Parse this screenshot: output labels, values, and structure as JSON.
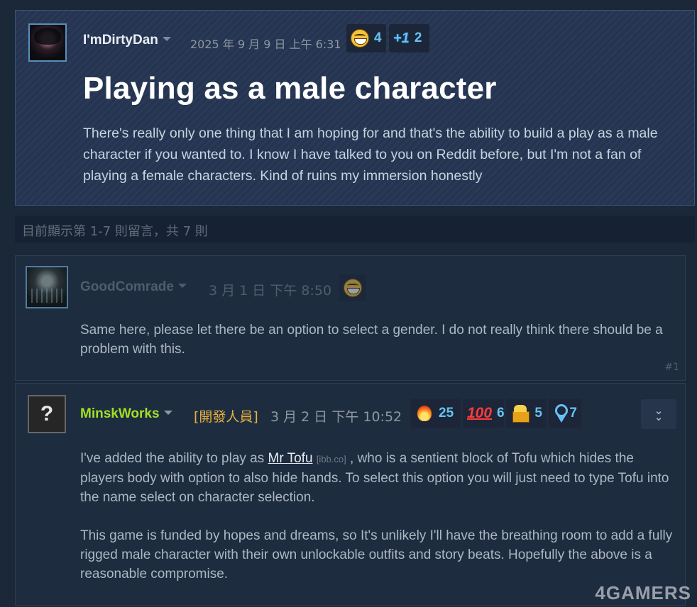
{
  "post": {
    "author": "I'mDirtyDan",
    "date": "2025 年 9 月 9 日 上午 6:31",
    "reactions": [
      {
        "icon": "grin-emoji-icon",
        "count": "4"
      },
      {
        "icon": "plus-one-icon",
        "count": "2"
      }
    ],
    "title": "Playing as a male character",
    "body": "There's really only one thing that I am hoping for and that's the ability to build a play as a male character if you wanted to. I know I have talked to you on Reddit before, but I'm not a fan of playing a female characters. Kind of ruins my immersion honestly"
  },
  "comments_info": "目前顯示第 1-7 則留言，共 7 則",
  "comments": [
    {
      "author": "GoodComrade",
      "date": "3 月 1 日 下午 8:50",
      "reaction_icon": "grin-emoji-icon",
      "body": "Same here, please let there be an option to select a gender. I do not really think there should be a problem with this.",
      "number": "#1"
    },
    {
      "author": "MinskWorks",
      "developer_tag": "[開發人員]",
      "date": "3 月 2 日 下午 10:52",
      "reactions": [
        {
          "icon": "fire-icon",
          "count": "25"
        },
        {
          "icon": "hundred-points-icon",
          "count": "6",
          "glyph": "100"
        },
        {
          "icon": "treasure-chest-icon",
          "count": "5"
        },
        {
          "icon": "award-medal-icon",
          "count": "7"
        }
      ],
      "body_p1_before": "I've added the ability to play as ",
      "link_text": "Mr Tofu",
      "link_domain": "[ibb.co]",
      "body_p1_after": " , who is a sentient block of Tofu which hides the players body with option to also hide hands. To select this option you will just need to type Tofu into the name select on character selection.",
      "body_p2": "This game is funded by hopes and dreams, so It's unlikely I'll have the breathing room to add a fully rigged male character with their own unlockable outfits and story beats. Hopefully the above is a reasonable compromise."
    }
  ],
  "avatar_placeholder": "?",
  "plus_one_glyph": "+1",
  "watermark": "4GAMERS",
  "colors": {
    "background": "#1b2838",
    "op_panel": "#243451",
    "comment_panel": "#1e2c40",
    "developer_name": "#a1e024",
    "developer_tag": "#e5b040",
    "reaction_count": "#67c1f5"
  }
}
